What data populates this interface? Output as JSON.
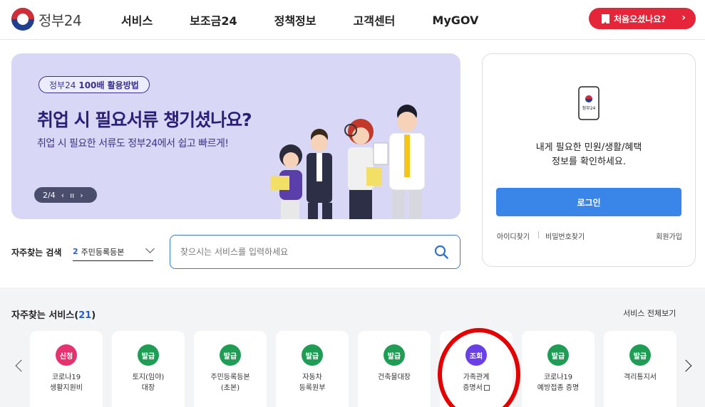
{
  "header": {
    "logo_text": "정부24",
    "nav": [
      "서비스",
      "보조금24",
      "정책정보",
      "고객센터",
      "MyGOV"
    ],
    "first_visit_label": "처음오셨나요?",
    "first_visit_chevron": "›"
  },
  "banner": {
    "tag_prefix": "정부24",
    "tag_bold": "100배 활용방법",
    "title": "취업 시 필요서류 챙기셨나요?",
    "subtitle": "취업 시 필요한 서류도 정부24에서 쉽고 빠르게!",
    "pager": "2/4",
    "prev": "‹",
    "pause": "ıı",
    "next": "›",
    "colors": {
      "background": "#d8d8f6",
      "title": "#2a1f7a"
    }
  },
  "search": {
    "label": "자주찾는 검색",
    "select_num": "2",
    "select_value": "주민등록등본",
    "placeholder": "찾으시는 서비스를 입력하세요"
  },
  "login": {
    "message_line1": "내게 필요한 민원/생활/혜택",
    "message_line2": "정보를 확인하세요.",
    "phone_caption": "정부24",
    "button": "로그인",
    "find_id": "아이디찾기",
    "find_pw": "비밀번호찾기",
    "join": "회원가입"
  },
  "services": {
    "title": "자주찾는 서비스",
    "count_open": "(",
    "count": "21",
    "count_close": ")",
    "view_all": "서비스 전체보기",
    "items": [
      {
        "badge": "신청",
        "badge_color": "#e6336f",
        "label": "코로나19\n생활지원비"
      },
      {
        "badge": "발급",
        "badge_color": "#1f9d55",
        "label": "토지(임야)\n대장"
      },
      {
        "badge": "발급",
        "badge_color": "#1f9d55",
        "label": "주민등록등본\n(초본)"
      },
      {
        "badge": "발급",
        "badge_color": "#1f9d55",
        "label": "자동차\n등록원부"
      },
      {
        "badge": "발급",
        "badge_color": "#1f9d55",
        "label": "건축물대장"
      },
      {
        "badge": "조회",
        "badge_color": "#6b3fe6",
        "label": "가족관계\n증명서"
      },
      {
        "badge": "발급",
        "badge_color": "#1f9d55",
        "label": "코로나19\n예방접종 증명"
      },
      {
        "badge": "발급",
        "badge_color": "#1f9d55",
        "label": "격리통지서"
      }
    ]
  }
}
